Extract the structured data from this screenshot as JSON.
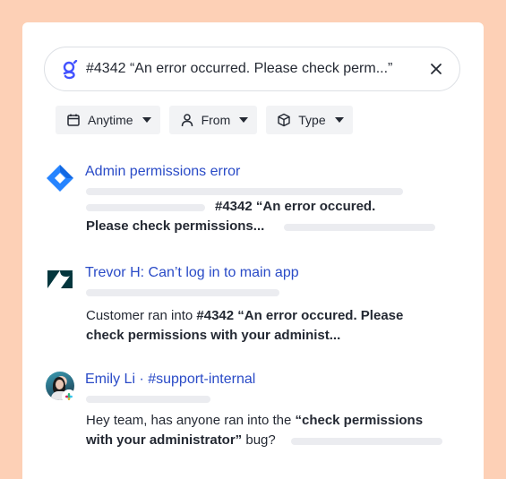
{
  "search": {
    "query": "#4342 “An error occurred. Please check perm...”"
  },
  "filters": [
    {
      "label": "Anytime",
      "icon": "calendar-icon"
    },
    {
      "label": "From",
      "icon": "person-icon"
    },
    {
      "label": "Type",
      "icon": "cube-icon"
    }
  ],
  "results": [
    {
      "source_icon": "jira-icon",
      "title": "Admin permissions error",
      "snippet_bold_1": "#4342 “An error occured.",
      "snippet_bold_2": "Please check permissions..."
    },
    {
      "source_icon": "zendesk-icon",
      "title": "Trevor H: Can’t log in to main app",
      "snippet_pre": "Customer ran into ",
      "snippet_bold_1": "#4342 “An error occured. Please",
      "snippet_bold_2": "check permissions with your administ..."
    },
    {
      "source_icon": "slack-icon",
      "title": "Emily Li · #support-internal",
      "snippet_pre": "Hey team, has anyone ran into the ",
      "snippet_bold_1": "“check permissions",
      "snippet_bold_2": "with your administrator”",
      "snippet_post": " bug?"
    }
  ],
  "colors": {
    "background": "#fdd0b6",
    "link": "#2a4bc7",
    "jira": "#2684ff",
    "zendesk": "#03363d",
    "brand": "#4353ff"
  }
}
